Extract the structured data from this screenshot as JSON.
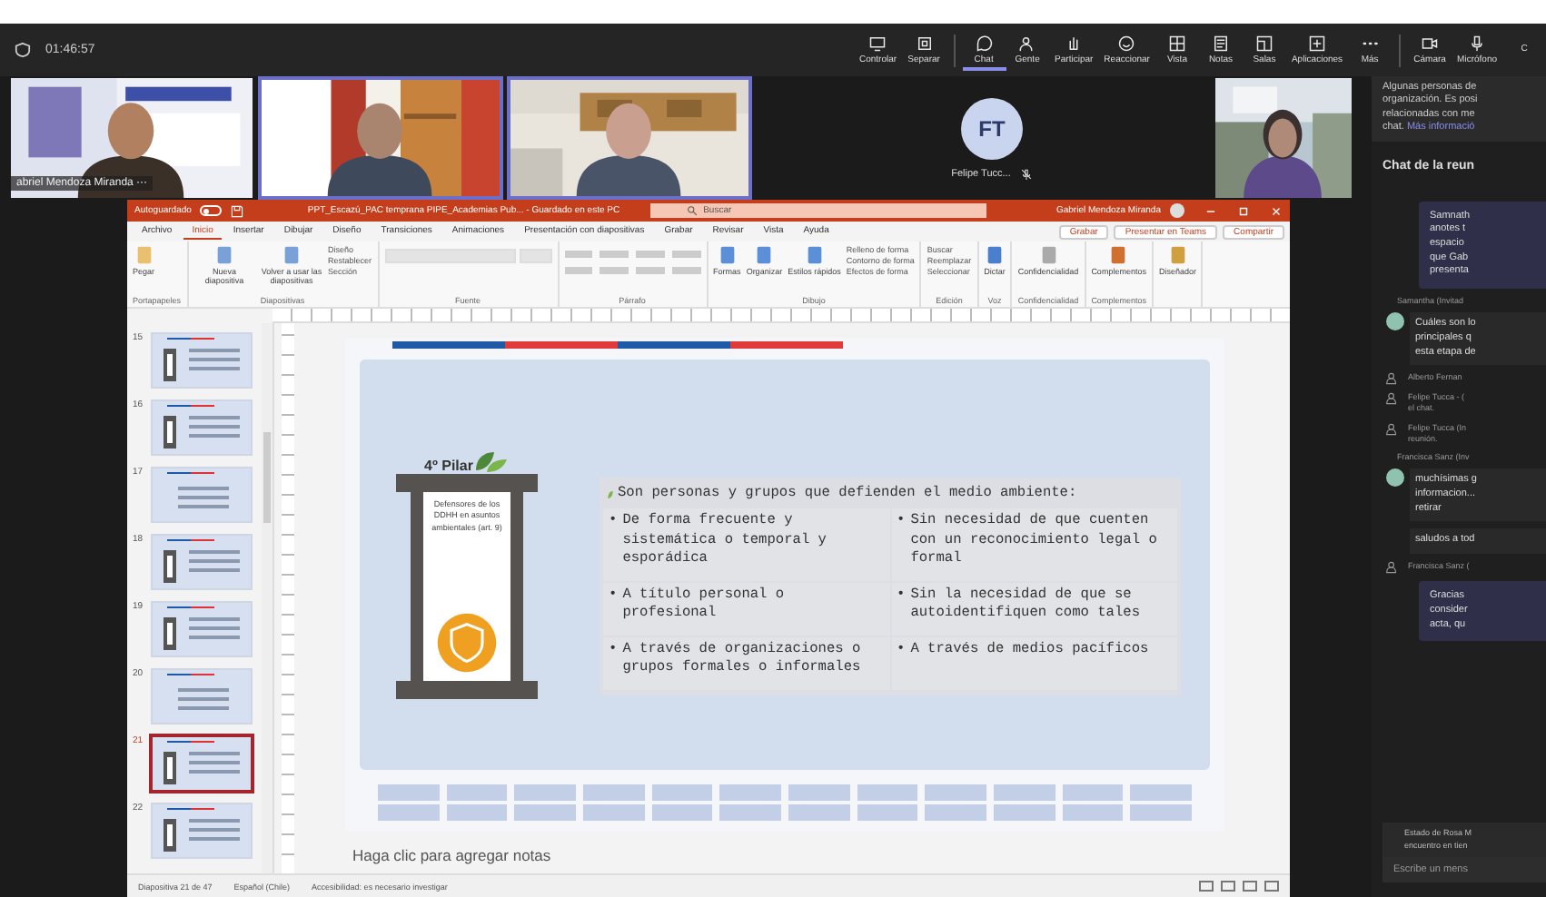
{
  "meeting": {
    "timer": "01:46:57",
    "toolbar": [
      {
        "label": "Controlar",
        "selected": false
      },
      {
        "label": "Separar",
        "selected": false
      },
      {
        "label": "Chat",
        "selected": true
      },
      {
        "label": "Gente",
        "selected": false
      },
      {
        "label": "Participar",
        "selected": false
      },
      {
        "label": "Reaccionar",
        "selected": false
      },
      {
        "label": "Vista",
        "selected": false
      },
      {
        "label": "Notas",
        "selected": false
      },
      {
        "label": "Salas",
        "selected": false
      },
      {
        "label": "Aplicaciones",
        "selected": false
      },
      {
        "label": "Más",
        "selected": false
      },
      {
        "label": "Cámara",
        "selected": false
      },
      {
        "label": "Micrófono",
        "selected": false
      },
      {
        "label": "C",
        "selected": false
      }
    ],
    "videos": [
      {
        "name": "abriel Mendoza Miranda",
        "more": "···",
        "speaking": false
      },
      {
        "speaking": true
      },
      {
        "speaking": true
      }
    ],
    "avatar": {
      "initials": "FT",
      "name": "Felipe Tucc...",
      "muted": true
    },
    "video_right": {
      "speaking": false
    }
  },
  "powerpoint": {
    "autosave_label": "Autoguardado",
    "autosave_on": false,
    "file_title": "PPT_Escazú_PAC temprana PIPE_Academias Pub... - Guardado en este PC",
    "search_placeholder": "Buscar",
    "user": "Gabriel Mendoza Miranda",
    "tabs": [
      {
        "label": "Archivo",
        "selected": false
      },
      {
        "label": "Inicio",
        "selected": true
      },
      {
        "label": "Insertar",
        "selected": false
      },
      {
        "label": "Dibujar",
        "selected": false
      },
      {
        "label": "Diseño",
        "selected": false
      },
      {
        "label": "Transiciones",
        "selected": false
      },
      {
        "label": "Animaciones",
        "selected": false
      },
      {
        "label": "Presentación con diapositivas",
        "selected": false
      },
      {
        "label": "Grabar",
        "selected": false
      },
      {
        "label": "Revisar",
        "selected": false
      },
      {
        "label": "Vista",
        "selected": false
      },
      {
        "label": "Ayuda",
        "selected": false
      }
    ],
    "actions": [
      "Grabar",
      "Presentar en Teams",
      "Compartir"
    ],
    "ribbon": [
      {
        "group": "Portapapeles",
        "buttons": [
          "Pegar"
        ]
      },
      {
        "group": "Diapositivas",
        "buttons": [
          "Nueva diapositiva",
          "Volver a usar las diapositivas"
        ],
        "small": [
          "Diseño",
          "Restablecer",
          "Sección"
        ]
      },
      {
        "group": "Fuente"
      },
      {
        "group": "Párrafo"
      },
      {
        "group": "Dibujo",
        "buttons": [
          "Formas",
          "Organizar",
          "Estilos rápidos"
        ],
        "small": [
          "Relleno de forma",
          "Contorno de forma",
          "Efectos de forma"
        ]
      },
      {
        "group": "Edición",
        "small": [
          "Buscar",
          "Reemplazar",
          "Seleccionar"
        ]
      },
      {
        "group": "Voz",
        "buttons": [
          "Dictar"
        ]
      },
      {
        "group": "Confidencialidad",
        "buttons": [
          "Confidencialidad"
        ]
      },
      {
        "group": "Complementos",
        "buttons": [
          "Complementos"
        ]
      },
      {
        "buttons": [
          "Diseñador"
        ]
      }
    ],
    "thumbnails": [
      {
        "number": "15",
        "kind": "pillar",
        "selected": false
      },
      {
        "number": "16",
        "kind": "pillar",
        "selected": false
      },
      {
        "number": "17",
        "kind": "text",
        "selected": false
      },
      {
        "number": "18",
        "kind": "pillar",
        "selected": false
      },
      {
        "number": "19",
        "kind": "pillar",
        "selected": false
      },
      {
        "number": "20",
        "kind": "text",
        "selected": false
      },
      {
        "number": "21",
        "kind": "pillar",
        "selected": true
      },
      {
        "number": "22",
        "kind": "pillar",
        "selected": false
      }
    ],
    "slide": {
      "pillar_title": "4º Pilar",
      "pillar_text": "Defensores de los DDHH en asuntos ambientales (art. 9)",
      "table_header": "Son personas y grupos que defienden el medio ambiente:",
      "bullet": "•",
      "cells": [
        "De forma frecuente y sistemática o temporal y esporádica",
        "Sin necesidad de que cuenten con un reconocimiento legal o formal",
        "A título personal o profesional",
        "Sin la necesidad de que se autoidentifiquen como tales",
        "A través de organizaciones o grupos formales o informales",
        "A través de medios pacíficos"
      ]
    },
    "notes_placeholder": "Haga clic para agregar notas",
    "status": [
      "Diapositiva 21 de 47",
      "Español (Chile)",
      "Accesibilidad: es necesario investigar"
    ]
  },
  "chat": {
    "notice": [
      "Algunas personas de",
      "organización. Es posi",
      "relacionadas con me"
    ],
    "notice_end": "chat.",
    "notice_link": "Más informació",
    "title": "Chat de la reun",
    "items": [
      {
        "kind": "own",
        "lines": [
          "Samnath",
          "anotes t",
          "espacio",
          "que Gab",
          "presenta"
        ]
      },
      {
        "kind": "sender",
        "text": "Samantha (Invitad"
      },
      {
        "kind": "other",
        "avatar": true,
        "lines": [
          "Cuáles son lo",
          "principales q",
          "esta etapa de"
        ]
      },
      {
        "kind": "event",
        "lines": [
          "Alberto Fernan"
        ]
      },
      {
        "kind": "event",
        "lines": [
          "Felipe Tucca - (",
          "el chat."
        ]
      },
      {
        "kind": "event",
        "lines": [
          "Felipe Tucca (In",
          "reunión."
        ]
      },
      {
        "kind": "sender",
        "text": "Francisca Sanz (Inv"
      },
      {
        "kind": "other",
        "avatar": true,
        "lines": [
          "muchísimas g",
          "informacion...",
          "retirar"
        ]
      },
      {
        "kind": "other",
        "avatar": false,
        "lines": [
          "saludos a tod"
        ]
      },
      {
        "kind": "event",
        "lines": [
          "Francisca Sanz ("
        ]
      },
      {
        "kind": "own",
        "lines": [
          "Gracias",
          "consider",
          "acta, qu"
        ]
      }
    ],
    "status_lines": [
      "Estado de Rosa M",
      "encuentro en tien"
    ],
    "compose_placeholder": "Escribe un mens"
  }
}
